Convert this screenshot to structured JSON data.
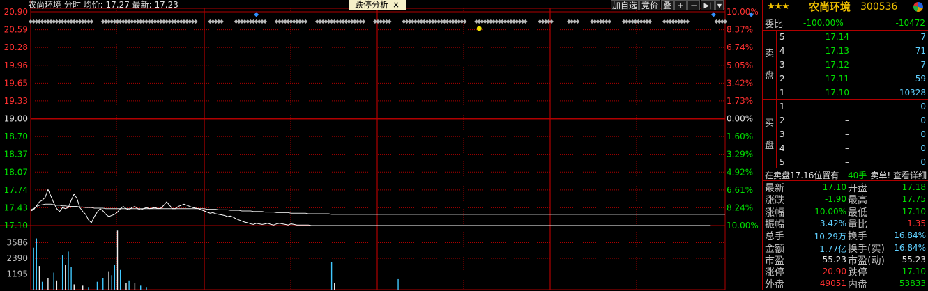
{
  "header": {
    "title": "农尚环境 分时 均价: 17.27 最新: 17.23",
    "tab_label": "跌停分析",
    "tab_close": "×",
    "btn_add": "加自选",
    "btn_bid": "竞价",
    "btn_overlay": "叠",
    "btn_plus": "+",
    "btn_minus": "−",
    "btn_next": "▶|",
    "btn_menu": "▼"
  },
  "price_axis": [
    "20.90",
    "20.59",
    "20.28",
    "19.96",
    "19.65",
    "19.33",
    "19.00",
    "18.70",
    "18.37",
    "18.07",
    "17.74",
    "17.43",
    "17.10"
  ],
  "pct_axis": [
    "10.00%",
    "8.37%",
    "6.74%",
    "5.05%",
    "3.42%",
    "1.73%",
    "0.00%",
    "1.60%",
    "3.29%",
    "4.92%",
    "6.61%",
    "8.24%",
    "10.00%"
  ],
  "volume_axis": [
    "3586",
    "2390",
    "1195"
  ],
  "chart_data": {
    "type": "line",
    "title": "农尚环境 分时",
    "ylim": [
      17.1,
      20.9
    ],
    "prev_close": 19.0,
    "series": [
      {
        "name": "price",
        "values": [
          17.36,
          17.38,
          17.45,
          17.52,
          17.55,
          17.6,
          17.74,
          17.62,
          17.5,
          17.4,
          17.35,
          17.42,
          17.4,
          17.42,
          17.55,
          17.66,
          17.58,
          17.42,
          17.35,
          17.3,
          17.2,
          17.15,
          17.26,
          17.34,
          17.4,
          17.36,
          17.3,
          17.26,
          17.28,
          17.3,
          17.34,
          17.4,
          17.44,
          17.4,
          17.38,
          17.42,
          17.44,
          17.4,
          17.38,
          17.4,
          17.42,
          17.4,
          17.41,
          17.42,
          17.4,
          17.41,
          17.46,
          17.52,
          17.46,
          17.4,
          17.4,
          17.44,
          17.46,
          17.48,
          17.46,
          17.44,
          17.42,
          17.41,
          17.4,
          17.38,
          17.36,
          17.34,
          17.32,
          17.33,
          17.31,
          17.3,
          17.29,
          17.28,
          17.26,
          17.27,
          17.25,
          17.22,
          17.2,
          17.18,
          17.16,
          17.15,
          17.13,
          17.12,
          17.14,
          17.13,
          17.12,
          17.13,
          17.14,
          17.12,
          17.11,
          17.13,
          17.14,
          17.13,
          17.12,
          17.11,
          17.13,
          17.12,
          17.11,
          17.11,
          17.11,
          17.11,
          17.11,
          17.1,
          17.1,
          17.1,
          17.1,
          17.1,
          17.1,
          17.1,
          17.1,
          17.1,
          17.1,
          17.1,
          17.1,
          17.1,
          17.1,
          17.1,
          17.1,
          17.1,
          17.1,
          17.1,
          17.1,
          17.1,
          17.1,
          17.1,
          17.1,
          17.1,
          17.1,
          17.1,
          17.1,
          17.1,
          17.1,
          17.1,
          17.1,
          17.1,
          17.1,
          17.1,
          17.1,
          17.1,
          17.1,
          17.1,
          17.1,
          17.1,
          17.1,
          17.1,
          17.1,
          17.1,
          17.1,
          17.1,
          17.1,
          17.1,
          17.1,
          17.1,
          17.1,
          17.1,
          17.1,
          17.1,
          17.1,
          17.1,
          17.1,
          17.1,
          17.1,
          17.1,
          17.1,
          17.1,
          17.1,
          17.1,
          17.1,
          17.1,
          17.1,
          17.1,
          17.1,
          17.1,
          17.1,
          17.1,
          17.1,
          17.1,
          17.1,
          17.1,
          17.1,
          17.1,
          17.1,
          17.1,
          17.1,
          17.1,
          17.1,
          17.1,
          17.1,
          17.1,
          17.1,
          17.1,
          17.1,
          17.1,
          17.1,
          17.1,
          17.1,
          17.1,
          17.1,
          17.1,
          17.1,
          17.1,
          17.1,
          17.1,
          17.1,
          17.1,
          17.1,
          17.1,
          17.1,
          17.1,
          17.1,
          17.1,
          17.1,
          17.1,
          17.1,
          17.1,
          17.1,
          17.1,
          17.1,
          17.1,
          17.1,
          17.1,
          17.1,
          17.1,
          17.1,
          17.1,
          17.1,
          17.1,
          17.1,
          17.1,
          17.1,
          17.1,
          17.1,
          17.1,
          17.1,
          17.1,
          17.1,
          17.1,
          17.1,
          17.1,
          17.1,
          17.1
        ]
      },
      {
        "name": "avg",
        "values": [
          17.38,
          17.4,
          17.44,
          17.46,
          17.47,
          17.48,
          17.48,
          17.48,
          17.47,
          17.46,
          17.46,
          17.45,
          17.45,
          17.44,
          17.44,
          17.44,
          17.44,
          17.43,
          17.43,
          17.42,
          17.42,
          17.42,
          17.41,
          17.41,
          17.41,
          17.41,
          17.4,
          17.4,
          17.4,
          17.4,
          17.4,
          17.4,
          17.4,
          17.4,
          17.4,
          17.4,
          17.4,
          17.4,
          17.4,
          17.4,
          17.4,
          17.4,
          17.4,
          17.4,
          17.4,
          17.4,
          17.4,
          17.4,
          17.4,
          17.4,
          17.4,
          17.4,
          17.4,
          17.4,
          17.4,
          17.4,
          17.4,
          17.4,
          17.4,
          17.4,
          17.4,
          17.39,
          17.39,
          17.39,
          17.39,
          17.38,
          17.38,
          17.38,
          17.38,
          17.37,
          17.37,
          17.37,
          17.37,
          17.36,
          17.36,
          17.36,
          17.36,
          17.35,
          17.35,
          17.35,
          17.35,
          17.34,
          17.34,
          17.34,
          17.34,
          17.33,
          17.33,
          17.33,
          17.33,
          17.33,
          17.32,
          17.32,
          17.32,
          17.32,
          17.32,
          17.32,
          17.31,
          17.31,
          17.31,
          17.31,
          17.31,
          17.31,
          17.31,
          17.31,
          17.3,
          17.3,
          17.3,
          17.3,
          17.3,
          17.3,
          17.3,
          17.3,
          17.3,
          17.3,
          17.3,
          17.3,
          17.3,
          17.3,
          17.3,
          17.3,
          17.3,
          17.3,
          17.3,
          17.3,
          17.3,
          17.3,
          17.3,
          17.3,
          17.3,
          17.3,
          17.3,
          17.3,
          17.3,
          17.3,
          17.3,
          17.3,
          17.3,
          17.3,
          17.3,
          17.3,
          17.3,
          17.3,
          17.3,
          17.3,
          17.3,
          17.3,
          17.3,
          17.3,
          17.3,
          17.3,
          17.3,
          17.3,
          17.3,
          17.3,
          17.3,
          17.3,
          17.3,
          17.3,
          17.3,
          17.3,
          17.3,
          17.3,
          17.3,
          17.3,
          17.3,
          17.3,
          17.3,
          17.3,
          17.3,
          17.3,
          17.3,
          17.3,
          17.3,
          17.3,
          17.3,
          17.3,
          17.3,
          17.3,
          17.3,
          17.3,
          17.3,
          17.3,
          17.3,
          17.3,
          17.3,
          17.3,
          17.3,
          17.3,
          17.3,
          17.3,
          17.3,
          17.3,
          17.3,
          17.3,
          17.3,
          17.3,
          17.3,
          17.3,
          17.3,
          17.3,
          17.3,
          17.3,
          17.3,
          17.3,
          17.3,
          17.3,
          17.3,
          17.3,
          17.3,
          17.3,
          17.3,
          17.3,
          17.3,
          17.3,
          17.3,
          17.3,
          17.3,
          17.3,
          17.3,
          17.3,
          17.3,
          17.3,
          17.3,
          17.3,
          17.3,
          17.3,
          17.3,
          17.3,
          17.3,
          17.3,
          17.3,
          17.3,
          17.3,
          17.3,
          17.3,
          17.3,
          17.3,
          17.3,
          17.3,
          17.3,
          17.3
        ]
      }
    ],
    "volume": [
      {
        "i": 1,
        "v": 3200
      },
      {
        "i": 2,
        "v": 3900
      },
      {
        "i": 3,
        "v": 1800
      },
      {
        "i": 4,
        "v": 600
      },
      {
        "i": 6,
        "v": 900
      },
      {
        "i": 8,
        "v": 1300
      },
      {
        "i": 9,
        "v": 700
      },
      {
        "i": 11,
        "v": 2600
      },
      {
        "i": 12,
        "v": 1900
      },
      {
        "i": 13,
        "v": 2900
      },
      {
        "i": 14,
        "v": 1700
      },
      {
        "i": 15,
        "v": 400
      },
      {
        "i": 18,
        "v": 300
      },
      {
        "i": 20,
        "v": 200
      },
      {
        "i": 23,
        "v": 600
      },
      {
        "i": 25,
        "v": 900
      },
      {
        "i": 27,
        "v": 1400
      },
      {
        "i": 28,
        "v": 1100
      },
      {
        "i": 29,
        "v": 1900
      },
      {
        "i": 30,
        "v": 4500
      },
      {
        "i": 31,
        "v": 1500
      },
      {
        "i": 33,
        "v": 500
      },
      {
        "i": 34,
        "v": 700
      },
      {
        "i": 36,
        "v": 500
      },
      {
        "i": 38,
        "v": 300
      },
      {
        "i": 40,
        "v": 200
      },
      {
        "i": 104,
        "v": 2100
      },
      {
        "i": 105,
        "v": 500
      },
      {
        "i": 127,
        "v": 800
      }
    ]
  },
  "signal_marks": [
    {
      "i": 78,
      "row": "top",
      "color": "#3090ff"
    },
    {
      "i": 155,
      "row": "low",
      "color": "#f0e000"
    },
    {
      "i": 236,
      "row": "top",
      "color": "#3090ff"
    },
    {
      "i": 249,
      "row": "top",
      "color": "#3090ff"
    }
  ],
  "signal_gaps": [
    [
      22,
      24
    ],
    [
      58,
      61
    ],
    [
      67,
      70
    ],
    [
      82,
      84
    ],
    [
      96,
      98
    ],
    [
      116,
      118
    ],
    [
      125,
      128
    ],
    [
      151,
      153
    ],
    [
      172,
      175
    ],
    [
      181,
      185
    ],
    [
      190,
      193
    ],
    [
      201,
      204
    ],
    [
      215,
      218
    ],
    [
      228,
      236
    ],
    [
      243,
      246
    ]
  ],
  "panel": {
    "stars": "★★★",
    "name": "农尚环境",
    "code": "300536",
    "weibi_label": "委比",
    "weibi_pct": "-100.00%",
    "weibi_val": "-10472",
    "sell_label_1": "卖",
    "sell_label_2": "盘",
    "buy_label_1": "买",
    "buy_label_2": "盘",
    "sell": [
      {
        "lvl": "5",
        "price": "17.14",
        "qty": "7"
      },
      {
        "lvl": "4",
        "price": "17.13",
        "qty": "71"
      },
      {
        "lvl": "3",
        "price": "17.12",
        "qty": "7"
      },
      {
        "lvl": "2",
        "price": "17.11",
        "qty": "59"
      },
      {
        "lvl": "1",
        "price": "17.10",
        "qty": "10328"
      }
    ],
    "buy": [
      {
        "lvl": "1",
        "price": "–",
        "qty": "0"
      },
      {
        "lvl": "2",
        "price": "–",
        "qty": "0"
      },
      {
        "lvl": "3",
        "price": "–",
        "qty": "0"
      },
      {
        "lvl": "4",
        "price": "–",
        "qty": "0"
      },
      {
        "lvl": "5",
        "price": "–",
        "qty": "0"
      }
    ],
    "info_left": "在卖盘17.16位置有",
    "info_mid": "40手",
    "info_right": "卖单! 查看详细",
    "stats": [
      {
        "l": "最新",
        "v": "17.10",
        "vc": "g",
        "l2": "开盘",
        "v2": "17.18",
        "v2c": "g"
      },
      {
        "l": "涨跌",
        "v": "-1.90",
        "vc": "g",
        "l2": "最高",
        "v2": "17.75",
        "v2c": "g"
      },
      {
        "l": "涨幅",
        "v": "-10.00%",
        "vc": "g",
        "l2": "最低",
        "v2": "17.10",
        "v2c": "g"
      },
      {
        "l": "振幅",
        "v": "3.42%",
        "vc": "c",
        "l2": "量比",
        "v2": "1.35",
        "v2c": "r"
      },
      {
        "l": "总手",
        "v": "10.29万",
        "vc": "c",
        "l2": "换手",
        "v2": "16.84%",
        "v2c": "c"
      },
      {
        "l": "金额",
        "v": "1.77亿",
        "vc": "c",
        "l2": "换手(实)",
        "v2": "16.84%",
        "v2c": "c"
      },
      {
        "l": "市盈",
        "v": "55.23",
        "vc": "w",
        "l2": "市盈(动)",
        "v2": "55.23",
        "v2c": "w"
      },
      {
        "l": "涨停",
        "v": "20.90",
        "vc": "r",
        "l2": "跌停",
        "v2": "17.10",
        "v2c": "g"
      },
      {
        "l": "外盘",
        "v": "49051",
        "vc": "r",
        "l2": "内盘",
        "v2": "53833",
        "v2c": "g"
      }
    ]
  }
}
